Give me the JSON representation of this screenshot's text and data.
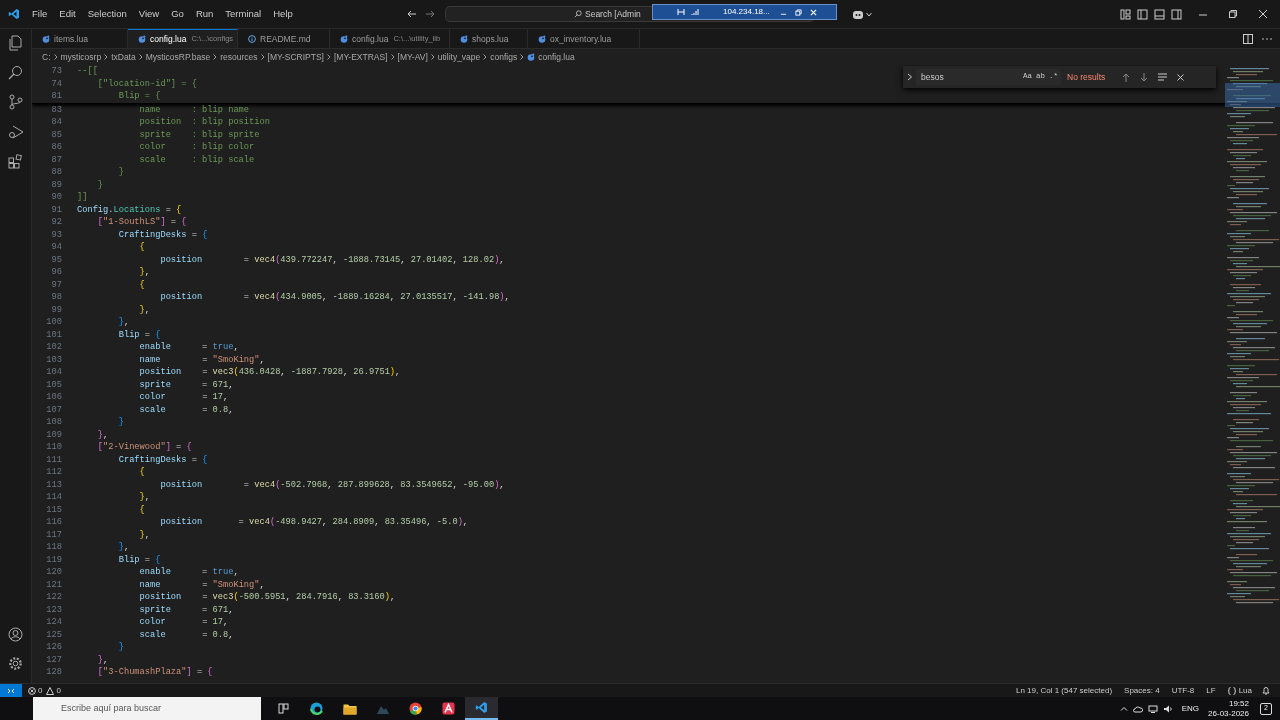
{
  "menu": [
    "File",
    "Edit",
    "Selection",
    "View",
    "Go",
    "Run",
    "Terminal",
    "Help"
  ],
  "command_center": {
    "text": "Search [Admin"
  },
  "remote_bar": {
    "host": "104.234.18..."
  },
  "tabs": [
    {
      "label": "items.lua",
      "selected": false,
      "kind": "script"
    },
    {
      "label": "config.lua",
      "path": "C:\\...\\configs",
      "selected": true,
      "kind": "script"
    },
    {
      "label": "README.md",
      "selected": false,
      "kind": "readme"
    },
    {
      "label": "config.lua",
      "path": "C:\\...\\utility_lib",
      "selected": false,
      "kind": "script"
    },
    {
      "label": "shops.lua",
      "selected": false,
      "kind": "script"
    },
    {
      "label": "ox_inventory.lua",
      "selected": false,
      "kind": "script"
    }
  ],
  "breadcrumbs": [
    "C:",
    "mysticosrp",
    "txData",
    "MysticosRP.base",
    "resources",
    "[MY-SCRIPTS]",
    "[MY-EXTRAS]",
    "[MY-AV]",
    "utility_vape",
    "configs",
    "config.lua"
  ],
  "find_widget": {
    "value": "besos",
    "result": "No results",
    "options": [
      "Aa",
      "ab",
      ".*"
    ]
  },
  "sticky_lines": [
    {
      "n": "73",
      "tokens": [
        {
          "kind": "comment",
          "text": "--[["
        }
      ]
    },
    {
      "n": "74",
      "tokens": [
        {
          "kind": "comment",
          "text": "    [\"location-id\"] = {"
        }
      ]
    },
    {
      "n": "81",
      "tokens": [
        {
          "kind": "comment",
          "text": "        Blip = {"
        }
      ]
    }
  ],
  "lines": [
    {
      "n": "83",
      "tokens": [
        {
          "kind": "comment",
          "text": "            name      : blip name"
        }
      ]
    },
    {
      "n": "84",
      "tokens": [
        {
          "kind": "comment",
          "text": "            position  : blip position"
        }
      ]
    },
    {
      "n": "85",
      "tokens": [
        {
          "kind": "comment",
          "text": "            sprite    : blip sprite"
        }
      ]
    },
    {
      "n": "86",
      "tokens": [
        {
          "kind": "comment",
          "text": "            color     : blip color"
        }
      ]
    },
    {
      "n": "87",
      "tokens": [
        {
          "kind": "comment",
          "text": "            scale     : blip scale"
        }
      ]
    },
    {
      "n": "88",
      "tokens": [
        {
          "kind": "comment",
          "text": "        }"
        }
      ]
    },
    {
      "n": "89",
      "tokens": [
        {
          "kind": "comment",
          "text": "    }"
        }
      ]
    },
    {
      "n": "90",
      "tokens": [
        {
          "kind": "comment",
          "text": "]]"
        }
      ]
    },
    {
      "n": "91",
      "tokens": [
        {
          "kind": "key",
          "text": "Config"
        },
        {
          "kind": "op",
          "text": "."
        },
        {
          "kind": "field",
          "text": "Locations"
        },
        {
          "kind": "op",
          "text": " = "
        },
        {
          "kind": "b1",
          "text": "{"
        }
      ]
    },
    {
      "n": "92",
      "tokens": [
        {
          "kind": "b2",
          "text": "    ["
        },
        {
          "kind": "string",
          "text": "\"1-SouthLS\""
        },
        {
          "kind": "b2",
          "text": "]"
        },
        {
          "kind": "op",
          "text": " = "
        },
        {
          "kind": "b2",
          "text": "{"
        }
      ]
    },
    {
      "n": "93",
      "tokens": [
        {
          "kind": "key",
          "text": "        CraftingDesks"
        },
        {
          "kind": "op",
          "text": " = "
        },
        {
          "kind": "b3",
          "text": "{"
        }
      ]
    },
    {
      "n": "94",
      "tokens": [
        {
          "kind": "b1",
          "text": "            {"
        }
      ]
    },
    {
      "n": "95",
      "tokens": [
        {
          "kind": "key",
          "text": "                position"
        },
        {
          "kind": "op",
          "text": "        = "
        },
        {
          "kind": "func",
          "text": "vec4"
        },
        {
          "kind": "b2",
          "text": "("
        },
        {
          "kind": "number",
          "text": "439.772247"
        },
        {
          "kind": "op",
          "text": ", -"
        },
        {
          "kind": "number",
          "text": "1888.73145"
        },
        {
          "kind": "op",
          "text": ", "
        },
        {
          "kind": "number",
          "text": "27.01402"
        },
        {
          "kind": "op",
          "text": ", "
        },
        {
          "kind": "number",
          "text": "128.02"
        },
        {
          "kind": "b2",
          "text": ")"
        },
        {
          "kind": "op",
          "text": ","
        }
      ]
    },
    {
      "n": "96",
      "tokens": [
        {
          "kind": "b1",
          "text": "            }"
        },
        {
          "kind": "op",
          "text": ","
        }
      ]
    },
    {
      "n": "97",
      "tokens": [
        {
          "kind": "b1",
          "text": "            {"
        }
      ]
    },
    {
      "n": "98",
      "tokens": [
        {
          "kind": "key",
          "text": "                position"
        },
        {
          "kind": "op",
          "text": "        = "
        },
        {
          "kind": "func",
          "text": "vec4"
        },
        {
          "kind": "b2",
          "text": "("
        },
        {
          "kind": "number",
          "text": "434.9005"
        },
        {
          "kind": "op",
          "text": ", -"
        },
        {
          "kind": "number",
          "text": "1889.16284"
        },
        {
          "kind": "op",
          "text": ", "
        },
        {
          "kind": "number",
          "text": "27.0135517"
        },
        {
          "kind": "op",
          "text": ", -"
        },
        {
          "kind": "number",
          "text": "141.98"
        },
        {
          "kind": "b2",
          "text": ")"
        },
        {
          "kind": "op",
          "text": ","
        }
      ]
    },
    {
      "n": "99",
      "tokens": [
        {
          "kind": "b1",
          "text": "            }"
        },
        {
          "kind": "op",
          "text": ","
        }
      ]
    },
    {
      "n": "100",
      "tokens": [
        {
          "kind": "b3",
          "text": "        }"
        },
        {
          "kind": "op",
          "text": ","
        }
      ]
    },
    {
      "n": "101",
      "tokens": [
        {
          "kind": "key",
          "text": "        Blip"
        },
        {
          "kind": "op",
          "text": " = "
        },
        {
          "kind": "b3",
          "text": "{"
        }
      ]
    },
    {
      "n": "102",
      "tokens": [
        {
          "kind": "key",
          "text": "            enable"
        },
        {
          "kind": "op",
          "text": "      = "
        },
        {
          "kind": "bool",
          "text": "true"
        },
        {
          "kind": "op",
          "text": ","
        }
      ]
    },
    {
      "n": "103",
      "tokens": [
        {
          "kind": "key",
          "text": "            name"
        },
        {
          "kind": "op",
          "text": "        = "
        },
        {
          "kind": "string",
          "text": "\"SmoKing\""
        },
        {
          "kind": "op",
          "text": ","
        }
      ]
    },
    {
      "n": "104",
      "tokens": [
        {
          "kind": "key",
          "text": "            position"
        },
        {
          "kind": "op",
          "text": "    = "
        },
        {
          "kind": "func",
          "text": "vec3"
        },
        {
          "kind": "b1",
          "text": "("
        },
        {
          "kind": "number",
          "text": "436.0428"
        },
        {
          "kind": "op",
          "text": ", -"
        },
        {
          "kind": "number",
          "text": "1887.7928"
        },
        {
          "kind": "op",
          "text": ", "
        },
        {
          "kind": "number",
          "text": "26.9751"
        },
        {
          "kind": "b1",
          "text": ")"
        },
        {
          "kind": "op",
          "text": ","
        }
      ]
    },
    {
      "n": "105",
      "tokens": [
        {
          "kind": "key",
          "text": "            sprite"
        },
        {
          "kind": "op",
          "text": "      = "
        },
        {
          "kind": "number",
          "text": "671"
        },
        {
          "kind": "op",
          "text": ","
        }
      ]
    },
    {
      "n": "106",
      "tokens": [
        {
          "kind": "key",
          "text": "            color"
        },
        {
          "kind": "op",
          "text": "       = "
        },
        {
          "kind": "number",
          "text": "17"
        },
        {
          "kind": "op",
          "text": ","
        }
      ]
    },
    {
      "n": "107",
      "tokens": [
        {
          "kind": "key",
          "text": "            scale"
        },
        {
          "kind": "op",
          "text": "       = "
        },
        {
          "kind": "number",
          "text": "0.8"
        },
        {
          "kind": "op",
          "text": ","
        }
      ]
    },
    {
      "n": "108",
      "tokens": [
        {
          "kind": "b3",
          "text": "        }"
        }
      ]
    },
    {
      "n": "109",
      "tokens": [
        {
          "kind": "b2",
          "text": "    }"
        },
        {
          "kind": "op",
          "text": ","
        }
      ]
    },
    {
      "n": "110",
      "tokens": [
        {
          "kind": "b2",
          "text": "    ["
        },
        {
          "kind": "string",
          "text": "\"2-Vinewood\""
        },
        {
          "kind": "b2",
          "text": "]"
        },
        {
          "kind": "op",
          "text": " = "
        },
        {
          "kind": "b2",
          "text": "{"
        }
      ]
    },
    {
      "n": "111",
      "tokens": [
        {
          "kind": "key",
          "text": "        CraftingDesks"
        },
        {
          "kind": "op",
          "text": " = "
        },
        {
          "kind": "b3",
          "text": "{"
        }
      ]
    },
    {
      "n": "112",
      "tokens": [
        {
          "kind": "b1",
          "text": "            {"
        }
      ]
    },
    {
      "n": "113",
      "tokens": [
        {
          "kind": "key",
          "text": "                position"
        },
        {
          "kind": "op",
          "text": "        = "
        },
        {
          "kind": "func",
          "text": "vec4"
        },
        {
          "kind": "b2",
          "text": "("
        },
        {
          "kind": "number",
          "text": "-502.7968"
        },
        {
          "kind": "op",
          "text": ", "
        },
        {
          "kind": "number",
          "text": "287.899628"
        },
        {
          "kind": "op",
          "text": ", "
        },
        {
          "kind": "number",
          "text": "83.3549652"
        },
        {
          "kind": "op",
          "text": ", -"
        },
        {
          "kind": "number",
          "text": "95.00"
        },
        {
          "kind": "b2",
          "text": ")"
        },
        {
          "kind": "op",
          "text": ","
        }
      ]
    },
    {
      "n": "114",
      "tokens": [
        {
          "kind": "b1",
          "text": "            }"
        },
        {
          "kind": "op",
          "text": ","
        }
      ]
    },
    {
      "n": "115",
      "tokens": [
        {
          "kind": "b1",
          "text": "            {"
        }
      ]
    },
    {
      "n": "116",
      "tokens": [
        {
          "kind": "key",
          "text": "                position"
        },
        {
          "kind": "op",
          "text": "       = "
        },
        {
          "kind": "func",
          "text": "vec4"
        },
        {
          "kind": "b2",
          "text": "("
        },
        {
          "kind": "number",
          "text": "-498.9427"
        },
        {
          "kind": "op",
          "text": ", "
        },
        {
          "kind": "number",
          "text": "284.8909"
        },
        {
          "kind": "op",
          "text": ", "
        },
        {
          "kind": "number",
          "text": "83.35496"
        },
        {
          "kind": "op",
          "text": ", -"
        },
        {
          "kind": "number",
          "text": "5.0"
        },
        {
          "kind": "b2",
          "text": ")"
        },
        {
          "kind": "op",
          "text": ","
        }
      ]
    },
    {
      "n": "117",
      "tokens": [
        {
          "kind": "b1",
          "text": "            }"
        },
        {
          "kind": "op",
          "text": ","
        }
      ]
    },
    {
      "n": "118",
      "tokens": [
        {
          "kind": "b3",
          "text": "        }"
        },
        {
          "kind": "op",
          "text": ","
        }
      ]
    },
    {
      "n": "119",
      "tokens": [
        {
          "kind": "key",
          "text": "        Blip"
        },
        {
          "kind": "op",
          "text": " = "
        },
        {
          "kind": "b3",
          "text": "{"
        }
      ]
    },
    {
      "n": "120",
      "tokens": [
        {
          "kind": "key",
          "text": "            enable"
        },
        {
          "kind": "op",
          "text": "      = "
        },
        {
          "kind": "bool",
          "text": "true"
        },
        {
          "kind": "op",
          "text": ","
        }
      ]
    },
    {
      "n": "121",
      "tokens": [
        {
          "kind": "key",
          "text": "            name"
        },
        {
          "kind": "op",
          "text": "        = "
        },
        {
          "kind": "string",
          "text": "\"SmoKing\""
        },
        {
          "kind": "op",
          "text": ","
        }
      ]
    },
    {
      "n": "122",
      "tokens": [
        {
          "kind": "key",
          "text": "            position"
        },
        {
          "kind": "op",
          "text": "    = "
        },
        {
          "kind": "func",
          "text": "vec3"
        },
        {
          "kind": "b1",
          "text": "("
        },
        {
          "kind": "number",
          "text": "-500.5951"
        },
        {
          "kind": "op",
          "text": ", "
        },
        {
          "kind": "number",
          "text": "284.7916"
        },
        {
          "kind": "op",
          "text": ", "
        },
        {
          "kind": "number",
          "text": "83.3160"
        },
        {
          "kind": "b1",
          "text": ")"
        },
        {
          "kind": "op",
          "text": ","
        }
      ]
    },
    {
      "n": "123",
      "tokens": [
        {
          "kind": "key",
          "text": "            sprite"
        },
        {
          "kind": "op",
          "text": "      = "
        },
        {
          "kind": "number",
          "text": "671"
        },
        {
          "kind": "op",
          "text": ","
        }
      ]
    },
    {
      "n": "124",
      "tokens": [
        {
          "kind": "key",
          "text": "            color"
        },
        {
          "kind": "op",
          "text": "       = "
        },
        {
          "kind": "number",
          "text": "17"
        },
        {
          "kind": "op",
          "text": ","
        }
      ]
    },
    {
      "n": "125",
      "tokens": [
        {
          "kind": "key",
          "text": "            scale"
        },
        {
          "kind": "op",
          "text": "       = "
        },
        {
          "kind": "number",
          "text": "0.8"
        },
        {
          "kind": "op",
          "text": ","
        }
      ]
    },
    {
      "n": "126",
      "tokens": [
        {
          "kind": "b3",
          "text": "        }"
        }
      ]
    },
    {
      "n": "127",
      "tokens": [
        {
          "kind": "b2",
          "text": "    }"
        },
        {
          "kind": "op",
          "text": ","
        }
      ]
    },
    {
      "n": "128",
      "tokens": [
        {
          "kind": "b2",
          "text": "    ["
        },
        {
          "kind": "string",
          "text": "\"3-ChumashPlaza\""
        },
        {
          "kind": "b2",
          "text": "]"
        },
        {
          "kind": "op",
          "text": " = "
        },
        {
          "kind": "b2",
          "text": "{"
        }
      ]
    }
  ],
  "status_bar": {
    "problems": {
      "errors": "0",
      "warnings": "0"
    },
    "right": [
      "Ln 19, Col 1 (547 selected)",
      "Spaces: 4",
      "UTF-8",
      "LF",
      "Lua"
    ]
  },
  "taskbar": {
    "search_placeholder": "Escribe aquí para buscar",
    "apps": [
      {
        "kind": "taskview",
        "selected": false
      },
      {
        "kind": "edge",
        "selected": false
      },
      {
        "kind": "folder",
        "selected": false
      },
      {
        "kind": "dark",
        "selected": false
      },
      {
        "kind": "chrome",
        "selected": false
      },
      {
        "kind": "redapp",
        "selected": false
      },
      {
        "kind": "vscode",
        "selected": true
      }
    ],
    "language": "ENG",
    "time": "19:52",
    "date": "26-03-2026",
    "notifications": "2"
  }
}
